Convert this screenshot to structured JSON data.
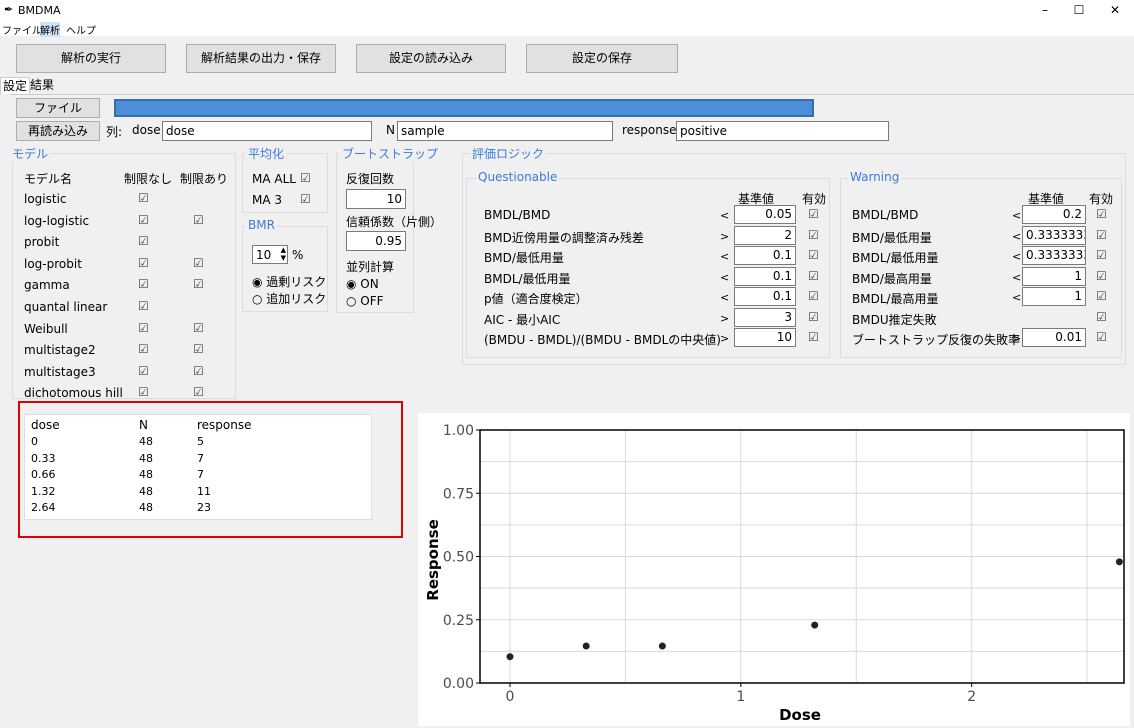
{
  "window": {
    "title": "BMDMA",
    "min": "–",
    "max": "☐",
    "close": "✕"
  },
  "menu": [
    "ファイル",
    "解析",
    "ヘルプ"
  ],
  "toolbar": [
    "解析の実行",
    "解析結果の出力・保存",
    "設定の読み込み",
    "設定の保存"
  ],
  "tabs": [
    "設定",
    "結果"
  ],
  "file_button": "ファイル",
  "reload_button": "再読み込み",
  "columns": {
    "label": "列:",
    "dose_label": "dose",
    "dose_value": "dose",
    "n_label": "N",
    "n_value": "sample",
    "response_label": "response",
    "response_value": "positive"
  },
  "models": {
    "title": "モデル",
    "head_name": "モデル名",
    "head_free": "制限なし",
    "head_restricted": "制限あり",
    "rows": [
      {
        "name": "logistic",
        "free": "☑",
        "restricted": ""
      },
      {
        "name": "log-logistic",
        "free": "☑",
        "restricted": "☑"
      },
      {
        "name": "probit",
        "free": "☑",
        "restricted": ""
      },
      {
        "name": "log-probit",
        "free": "☑",
        "restricted": "☑"
      },
      {
        "name": "gamma",
        "free": "☑",
        "restricted": "☑"
      },
      {
        "name": "quantal linear",
        "free": "☑",
        "restricted": ""
      },
      {
        "name": "Weibull",
        "free": "☑",
        "restricted": "☑"
      },
      {
        "name": "multistage2",
        "free": "☑",
        "restricted": "☑"
      },
      {
        "name": "multistage3",
        "free": "☑",
        "restricted": "☑"
      },
      {
        "name": "dichotomous hill",
        "free": "☑",
        "restricted": "☑"
      }
    ]
  },
  "averaging": {
    "title": "平均化",
    "ma_all": "MA ALL",
    "ma3": "MA 3",
    "check": "☑"
  },
  "bmr": {
    "title": "BMR",
    "value": "10",
    "unit": "%",
    "excess": "◉ 過剰リスク",
    "added": "○ 追加リスク"
  },
  "bootstrap": {
    "title": "ブートストラップ",
    "iter_label": "反復回数",
    "iter_value": "10",
    "conf_label": "信頼係数（片側）",
    "conf_value": "0.95",
    "parallel_label": "並列計算",
    "on": "◉ ON",
    "off": "○ OFF"
  },
  "logic": {
    "title": "評価ロジック",
    "questionable": {
      "title": "Questionable",
      "head_val": "基準値",
      "head_on": "有効",
      "rows": [
        {
          "label": "BMDL/BMD",
          "op": "<",
          "value": "0.05",
          "on": "☑"
        },
        {
          "label": "BMD近傍用量の調整済み残差",
          "op": ">",
          "value": "2",
          "on": "☑"
        },
        {
          "label": "BMD/最低用量",
          "op": "<",
          "value": "0.1",
          "on": "☑"
        },
        {
          "label": "BMDL/最低用量",
          "op": "<",
          "value": "0.1",
          "on": "☑"
        },
        {
          "label": "p値（適合度検定）",
          "op": "<",
          "value": "0.1",
          "on": "☑"
        },
        {
          "label": "AIC - 最小AIC",
          "op": ">",
          "value": "3",
          "on": "☑"
        },
        {
          "label": "(BMDU - BMDL)/(BMDU - BMDLの中央値)",
          "op": ">",
          "value": "10",
          "on": "☑"
        }
      ]
    },
    "warning": {
      "title": "Warning",
      "head_val": "基準値",
      "head_on": "有効",
      "rows": [
        {
          "label": "BMDL/BMD",
          "op": "<",
          "value": "0.2",
          "on": "☑"
        },
        {
          "label": "BMD/最低用量",
          "op": "<",
          "value": "0.3333333",
          "on": "☑"
        },
        {
          "label": "BMDL/最低用量",
          "op": "<",
          "value": "0.3333333",
          "on": "☑"
        },
        {
          "label": "BMD/最高用量",
          "op": "<",
          "value": "1",
          "on": "☑"
        },
        {
          "label": "BMDL/最高用量",
          "op": "<",
          "value": "1",
          "on": "☑"
        },
        {
          "label": "BMDU推定失敗",
          "op": "",
          "value": "",
          "on": "☑"
        },
        {
          "label": "ブートストラップ反復の失敗率",
          "op": ">",
          "value": "0.01",
          "on": "☑"
        }
      ]
    }
  },
  "table": {
    "headers": [
      "dose",
      "N",
      "response"
    ],
    "rows": [
      [
        "0",
        "48",
        "5"
      ],
      [
        "0.33",
        "48",
        "7"
      ],
      [
        "0.66",
        "48",
        "7"
      ],
      [
        "1.32",
        "48",
        "11"
      ],
      [
        "2.64",
        "48",
        "23"
      ]
    ]
  },
  "chart_data": {
    "type": "scatter",
    "x": [
      0,
      0.33,
      0.66,
      1.32,
      2.64
    ],
    "y": [
      0.104,
      0.146,
      0.146,
      0.229,
      0.479
    ],
    "xlabel": "Dose",
    "ylabel": "Response",
    "xlim": [
      -0.13,
      2.66
    ],
    "ylim": [
      0,
      1
    ],
    "xticks": [
      0,
      1,
      2
    ],
    "yticks": [
      "0.00",
      "0.25",
      "0.50",
      "0.75",
      "1.00"
    ],
    "grid": true
  }
}
